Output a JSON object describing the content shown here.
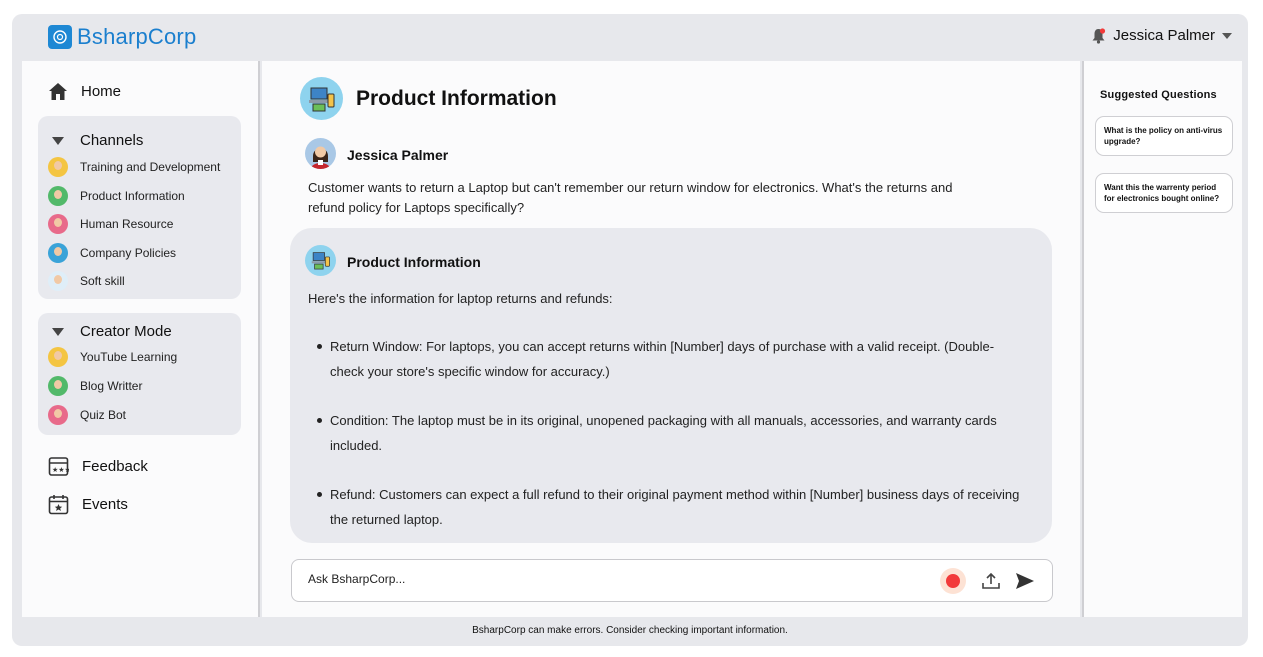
{
  "app": {
    "brand": "BsharpCorp"
  },
  "user_menu": {
    "name": "Jessica Palmer",
    "icon": "bell-icon"
  },
  "sidebar": {
    "home": "Home",
    "channels": {
      "label": "Channels",
      "items": [
        {
          "label": "Training and Development",
          "avatar": "#f4c542"
        },
        {
          "label": "Product Information",
          "avatar": "#52b96a"
        },
        {
          "label": "Human Resource",
          "avatar": "#e86a8a"
        },
        {
          "label": "Company Policies",
          "avatar": "#3aa3d8"
        },
        {
          "label": "Soft skill",
          "avatar": "#dfeef8"
        }
      ]
    },
    "creator": {
      "label": "Creator Mode",
      "items": [
        {
          "label": "YouTube Learning",
          "avatar": "#f4c542"
        },
        {
          "label": "Blog Writter",
          "avatar": "#52b96a"
        },
        {
          "label": "Quiz Bot",
          "avatar": "#e86a8a"
        }
      ]
    },
    "feedback": "Feedback",
    "events": "Events"
  },
  "main": {
    "title": "Product Information",
    "user_message": {
      "name": "Jessica Palmer",
      "text": "Customer wants to return a Laptop but can't remember our return window for electronics. What's the returns and refund policy for Laptops specifically?"
    },
    "bot_message": {
      "name": "Product Information",
      "intro": "Here's the information for laptop returns and refunds:",
      "bullets": [
        "Return Window: For laptops, you can accept returns within [Number] days of purchase with a valid receipt. (Double-check your store's specific window for accuracy.)",
        "Condition: The laptop must be in its original, unopened packaging with all manuals, accessories, and warranty cards included.",
        "Refund: Customers can expect a full refund to their original payment method within [Number] business days of receiving the returned laptop."
      ]
    },
    "input": {
      "placeholder": "Ask BsharpCorp..."
    }
  },
  "suggested": {
    "title": "Suggested Questions",
    "items": [
      "What is the policy on anti-virus upgrade?",
      "Want this the warrenty period for electronics bought online?"
    ]
  },
  "footer": "BsharpCorp can make errors. Consider checking important information.",
  "colors": {
    "brand": "#1b7fce",
    "record": "#f23a3a"
  }
}
